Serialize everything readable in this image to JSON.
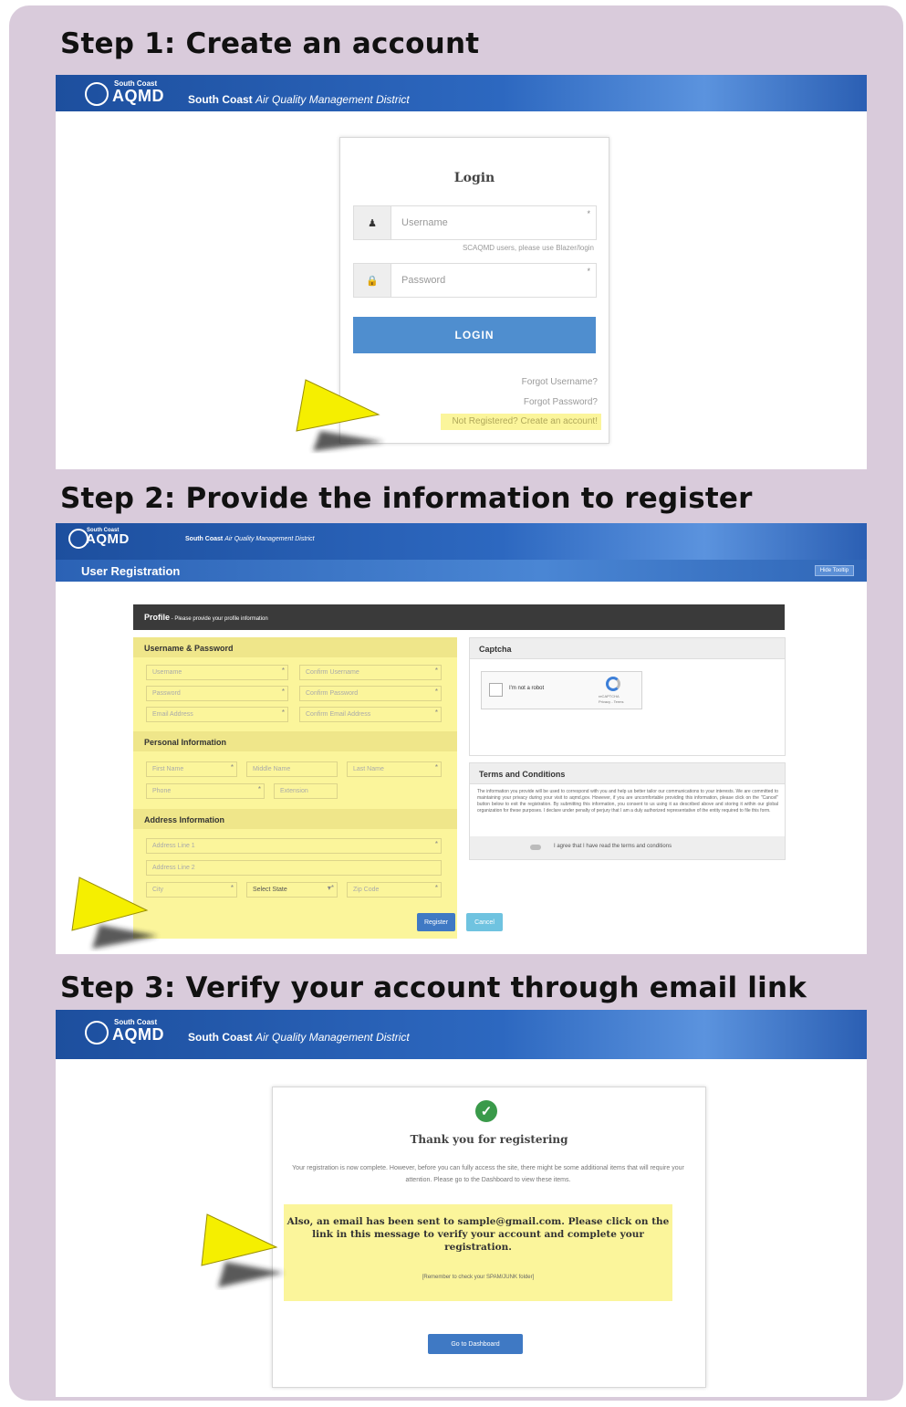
{
  "steps": [
    {
      "title": "Step 1: Create an account"
    },
    {
      "title": "Step 2: Provide the information to register"
    },
    {
      "title": "Step 3: Verify your account through email link"
    }
  ],
  "brand": {
    "logo_small_line1": "South",
    "logo_small_line2": "Coast",
    "logo": "AQMD",
    "name_bold": "South Coast",
    "name_italic": "Air Quality Management District"
  },
  "login": {
    "title": "Login",
    "username_placeholder": "Username",
    "username_hint": "SCAQMD users, please use Blazer/login",
    "password_placeholder": "Password",
    "button": "LOGIN",
    "forgot_username": "Forgot Username?",
    "forgot_password": "Forgot Password?",
    "register_link": "Not Registered? Create an account!"
  },
  "registration": {
    "bar_title": "User Registration",
    "bar_button": "Hide Tooltip",
    "profile_title": "Profile",
    "profile_subtitle": " - Please provide your profile information",
    "section_username": "Username & Password",
    "username": "Username",
    "confirm_username": "Confirm Username",
    "password": "Password",
    "confirm_password": "Confirm Password",
    "email": "Email Address",
    "confirm_email": "Confirm Email Address",
    "section_personal": "Personal Information",
    "first_name": "First Name",
    "middle_name": "Middle Name",
    "last_name": "Last Name",
    "phone": "Phone",
    "extension": "Extension",
    "section_address": "Address Information",
    "address1": "Address Line 1",
    "address2": "Address Line 2",
    "city": "City",
    "state": "Select State",
    "zip": "Zip Code",
    "captcha_title": "Captcha",
    "captcha_label": "I'm not a robot",
    "captcha_brand": "reCAPTCHA",
    "captcha_links": "Privacy - Terms",
    "terms_title": "Terms and Conditions",
    "terms_text": "The information you provide will be used to correspond with you and help us better tailor our communications to your interests. We are committed to maintaining your privacy during your visit to aqmd.gov. However, if you are uncomfortable providing this information, please click on the \"Cancel\" button below to exit the registration. By submitting this information, you consent to us using it as described above and storing it within our global organization for these purposes. I declare under penalty of perjury that I am a duly authorized representative of the entity required to file this form.",
    "agree_label": "I agree that I have read the terms and conditions",
    "register_button": "Register",
    "cancel_button": "Cancel"
  },
  "verify": {
    "title": "Thank you for registering",
    "body": "Your registration is now complete. However, before you can fully access the site, there might be some additional items that will require your attention. Please go to the Dashboard to view these items.",
    "email_notice": "Also, an email has been sent to sample@gmail.com. Please click on the link in this message to verify your account and complete your registration.",
    "spam_note": "[Remember to check your SPAM/JUNK folder]",
    "dashboard_button": "Go to Dashboard"
  },
  "colors": {
    "panel": "#d9cbdb",
    "highlight": "#fbf59b",
    "arrow": "#f5ef00",
    "banner": "#2d68c0",
    "button": "#4f8ecf",
    "success": "#3a9a4a"
  }
}
